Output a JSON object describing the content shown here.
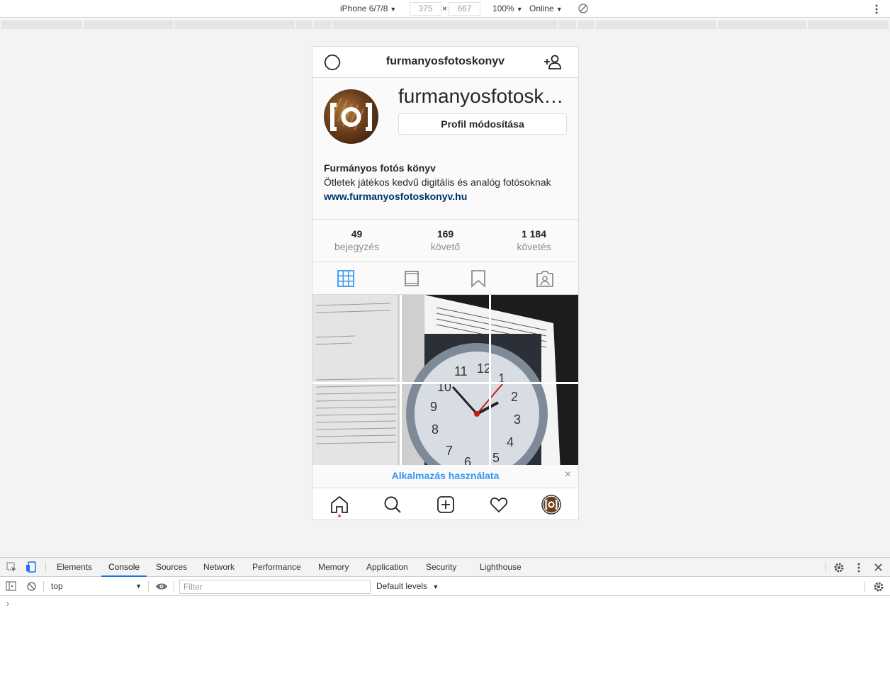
{
  "device_toolbar": {
    "device": "iPhone 6/7/8",
    "width": "375",
    "times": "×",
    "height": "667",
    "zoom": "100%",
    "network": "Online"
  },
  "instagram": {
    "header_title": "furmanyosfotoskonyv",
    "username": "furmanyosfotoskonyv",
    "edit_profile_label": "Profil módosítása",
    "bio_name": "Furmányos fotós könyv",
    "bio_text": "Ötletek játékos kedvű digitális és analóg fotósoknak",
    "bio_link": "www.furmanyosfotoskonyv.hu",
    "stats": [
      {
        "num": "49",
        "label": "bejegyzés"
      },
      {
        "num": "169",
        "label": "követő"
      },
      {
        "num": "1 184",
        "label": "követés"
      }
    ],
    "app_banner": "Alkalmazás használata",
    "close_symbol": "×",
    "colors": {
      "accent": "#3897f0",
      "link": "#003569",
      "notification": "#ed4956"
    }
  },
  "devtools": {
    "tabs": [
      "Elements",
      "Console",
      "Sources",
      "Network",
      "Performance",
      "Memory",
      "Application",
      "Security",
      "Lighthouse"
    ],
    "active_tab": "Console",
    "context": "top",
    "filter_placeholder": "Filter",
    "levels": "Default levels",
    "prompt": "›"
  }
}
